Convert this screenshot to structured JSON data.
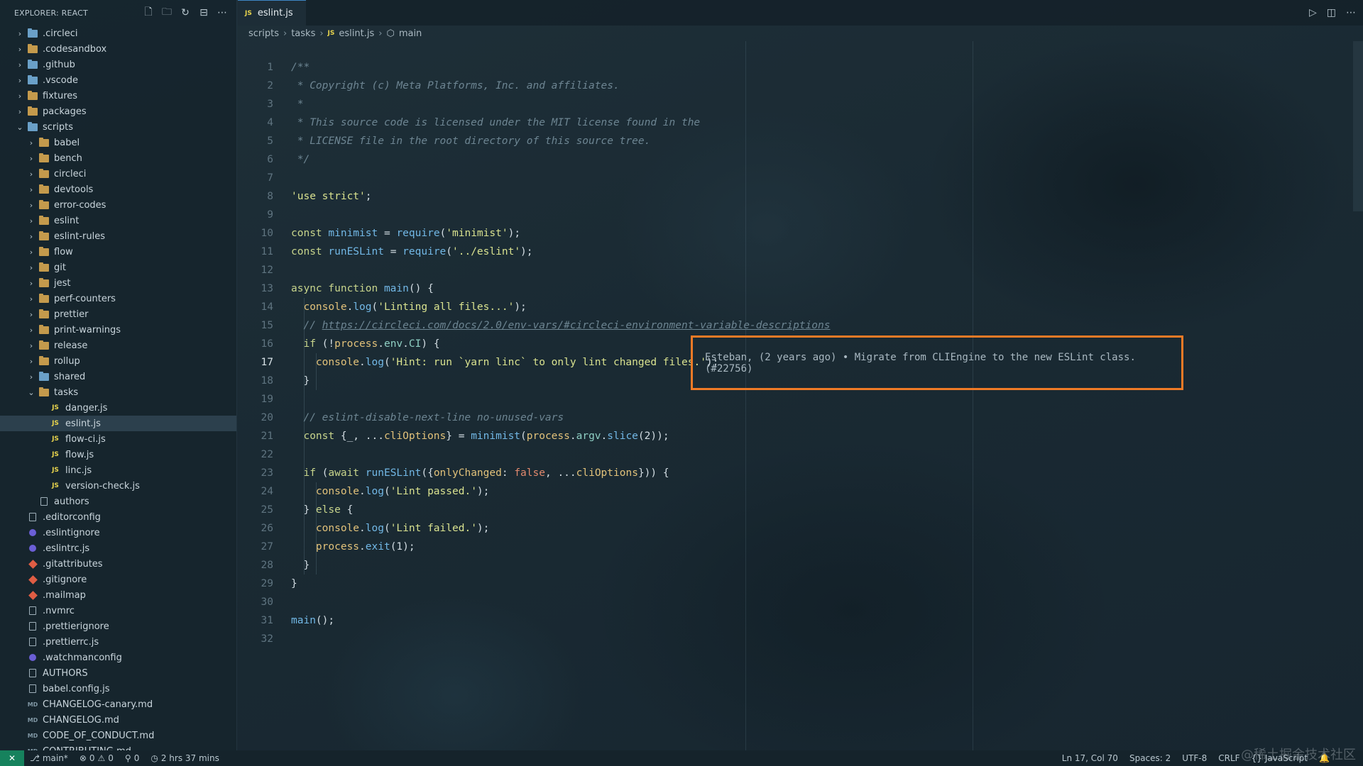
{
  "explorer": {
    "title": "EXPLORER: REACT",
    "actions": [
      "new-file-icon",
      "new-folder-icon",
      "refresh-icon",
      "collapse-icon",
      "more-icon"
    ],
    "items": [
      {
        "label": ".circleci",
        "kind": "folder-special",
        "depth": 0,
        "open": false
      },
      {
        "label": ".codesandbox",
        "kind": "folder",
        "depth": 0,
        "open": false
      },
      {
        "label": ".github",
        "kind": "folder-special",
        "depth": 0,
        "open": false
      },
      {
        "label": ".vscode",
        "kind": "folder-special",
        "depth": 0,
        "open": false
      },
      {
        "label": "fixtures",
        "kind": "folder",
        "depth": 0,
        "open": false
      },
      {
        "label": "packages",
        "kind": "folder",
        "depth": 0,
        "open": false
      },
      {
        "label": "scripts",
        "kind": "folder-special",
        "depth": 0,
        "open": true
      },
      {
        "label": "babel",
        "kind": "folder",
        "depth": 1,
        "open": false
      },
      {
        "label": "bench",
        "kind": "folder",
        "depth": 1,
        "open": false
      },
      {
        "label": "circleci",
        "kind": "folder",
        "depth": 1,
        "open": false
      },
      {
        "label": "devtools",
        "kind": "folder",
        "depth": 1,
        "open": false
      },
      {
        "label": "error-codes",
        "kind": "folder",
        "depth": 1,
        "open": false
      },
      {
        "label": "eslint",
        "kind": "folder",
        "depth": 1,
        "open": false
      },
      {
        "label": "eslint-rules",
        "kind": "folder",
        "depth": 1,
        "open": false
      },
      {
        "label": "flow",
        "kind": "folder",
        "depth": 1,
        "open": false
      },
      {
        "label": "git",
        "kind": "folder",
        "depth": 1,
        "open": false
      },
      {
        "label": "jest",
        "kind": "folder",
        "depth": 1,
        "open": false
      },
      {
        "label": "perf-counters",
        "kind": "folder",
        "depth": 1,
        "open": false
      },
      {
        "label": "prettier",
        "kind": "folder",
        "depth": 1,
        "open": false
      },
      {
        "label": "print-warnings",
        "kind": "folder",
        "depth": 1,
        "open": false
      },
      {
        "label": "release",
        "kind": "folder",
        "depth": 1,
        "open": false
      },
      {
        "label": "rollup",
        "kind": "folder",
        "depth": 1,
        "open": false
      },
      {
        "label": "shared",
        "kind": "folder-special",
        "depth": 1,
        "open": false
      },
      {
        "label": "tasks",
        "kind": "folder",
        "depth": 1,
        "open": true
      },
      {
        "label": "danger.js",
        "kind": "js",
        "depth": 2
      },
      {
        "label": "eslint.js",
        "kind": "js",
        "depth": 2,
        "active": true
      },
      {
        "label": "flow-ci.js",
        "kind": "js",
        "depth": 2
      },
      {
        "label": "flow.js",
        "kind": "js",
        "depth": 2
      },
      {
        "label": "linc.js",
        "kind": "js",
        "depth": 2
      },
      {
        "label": "version-check.js",
        "kind": "js",
        "depth": 2
      },
      {
        "label": "authors",
        "kind": "file",
        "depth": 1
      },
      {
        "label": ".editorconfig",
        "kind": "file",
        "depth": 0
      },
      {
        "label": ".eslintignore",
        "kind": "dot",
        "depth": 0
      },
      {
        "label": ".eslintrc.js",
        "kind": "dot",
        "depth": 0
      },
      {
        "label": ".gitattributes",
        "kind": "git",
        "depth": 0
      },
      {
        "label": ".gitignore",
        "kind": "git",
        "depth": 0
      },
      {
        "label": ".mailmap",
        "kind": "git",
        "depth": 0
      },
      {
        "label": ".nvmrc",
        "kind": "file",
        "depth": 0
      },
      {
        "label": ".prettierignore",
        "kind": "file",
        "depth": 0
      },
      {
        "label": ".prettierrc.js",
        "kind": "file",
        "depth": 0
      },
      {
        "label": ".watchmanconfig",
        "kind": "dot",
        "depth": 0
      },
      {
        "label": "AUTHORS",
        "kind": "file",
        "depth": 0
      },
      {
        "label": "babel.config.js",
        "kind": "file",
        "depth": 0
      },
      {
        "label": "CHANGELOG-canary.md",
        "kind": "md",
        "depth": 0
      },
      {
        "label": "CHANGELOG.md",
        "kind": "md",
        "depth": 0
      },
      {
        "label": "CODE_OF_CONDUCT.md",
        "kind": "md",
        "depth": 0
      },
      {
        "label": "CONTRIBUTING.md",
        "kind": "md",
        "depth": 0
      }
    ]
  },
  "tab": {
    "icon": "JS",
    "label": "eslint.js"
  },
  "editor_actions": [
    "run-icon",
    "split-editor-icon",
    "more-icon"
  ],
  "breadcrumb": {
    "parts": [
      "scripts",
      "tasks",
      "eslint.js",
      "main"
    ],
    "js_icon": "JS"
  },
  "code": {
    "current_line": 17,
    "lines": [
      [
        {
          "t": "/**",
          "c": "com"
        }
      ],
      [
        {
          "t": " * Copyright (c) Meta Platforms, Inc. and affiliates.",
          "c": "com"
        }
      ],
      [
        {
          "t": " *",
          "c": "com"
        }
      ],
      [
        {
          "t": " * This source code is licensed under the MIT license found in the",
          "c": "com"
        }
      ],
      [
        {
          "t": " * LICENSE file in the root directory of this source tree.",
          "c": "com"
        }
      ],
      [
        {
          "t": " */",
          "c": "com"
        }
      ],
      [],
      [
        {
          "t": "'use strict'",
          "c": "str"
        },
        {
          "t": ";",
          "c": "pl"
        }
      ],
      [],
      [
        {
          "t": "const ",
          "c": "kw"
        },
        {
          "t": "minimist",
          "c": "fn"
        },
        {
          "t": " = ",
          "c": "pl"
        },
        {
          "t": "require",
          "c": "fn"
        },
        {
          "t": "(",
          "c": "pl"
        },
        {
          "t": "'minimist'",
          "c": "str"
        },
        {
          "t": ");",
          "c": "pl"
        }
      ],
      [
        {
          "t": "const ",
          "c": "kw"
        },
        {
          "t": "runESLint",
          "c": "fn"
        },
        {
          "t": " = ",
          "c": "pl"
        },
        {
          "t": "require",
          "c": "fn"
        },
        {
          "t": "(",
          "c": "pl"
        },
        {
          "t": "'../eslint'",
          "c": "str"
        },
        {
          "t": ");",
          "c": "pl"
        }
      ],
      [],
      [
        {
          "t": "async function ",
          "c": "kw"
        },
        {
          "t": "main",
          "c": "fn"
        },
        {
          "t": "() {",
          "c": "pl"
        }
      ],
      [
        {
          "t": "  console",
          "c": "var"
        },
        {
          "t": ".",
          "c": "pl"
        },
        {
          "t": "log",
          "c": "fn"
        },
        {
          "t": "(",
          "c": "pl"
        },
        {
          "t": "'Linting all files...'",
          "c": "str"
        },
        {
          "t": ");",
          "c": "pl"
        }
      ],
      [
        {
          "t": "  // ",
          "c": "com"
        },
        {
          "t": "https://circleci.com/docs/2.0/env-vars/#circleci-environment-variable-descriptions",
          "c": "url"
        }
      ],
      [
        {
          "t": "  if ",
          "c": "kw"
        },
        {
          "t": "(!",
          "c": "pl"
        },
        {
          "t": "process",
          "c": "var"
        },
        {
          "t": ".",
          "c": "pl"
        },
        {
          "t": "env",
          "c": "pr"
        },
        {
          "t": ".",
          "c": "pl"
        },
        {
          "t": "CI",
          "c": "pr"
        },
        {
          "t": ") {",
          "c": "pl"
        }
      ],
      [
        {
          "t": "    console",
          "c": "var"
        },
        {
          "t": ".",
          "c": "pl"
        },
        {
          "t": "log",
          "c": "fn"
        },
        {
          "t": "(",
          "c": "pl"
        },
        {
          "t": "'Hint: run `yarn linc` to only lint changed files.'",
          "c": "str"
        },
        {
          "t": ");",
          "c": "pl"
        }
      ],
      [
        {
          "t": "  }",
          "c": "pl"
        }
      ],
      [],
      [
        {
          "t": "  // eslint-disable-next-line no-unused-vars",
          "c": "com"
        }
      ],
      [
        {
          "t": "  const ",
          "c": "kw"
        },
        {
          "t": "{_, ...",
          "c": "pl"
        },
        {
          "t": "cliOptions",
          "c": "var"
        },
        {
          "t": "} = ",
          "c": "pl"
        },
        {
          "t": "minimist",
          "c": "fn"
        },
        {
          "t": "(",
          "c": "pl"
        },
        {
          "t": "process",
          "c": "var"
        },
        {
          "t": ".",
          "c": "pl"
        },
        {
          "t": "argv",
          "c": "pr"
        },
        {
          "t": ".",
          "c": "pl"
        },
        {
          "t": "slice",
          "c": "fn"
        },
        {
          "t": "(2));",
          "c": "pl"
        }
      ],
      [],
      [
        {
          "t": "  if ",
          "c": "kw"
        },
        {
          "t": "(",
          "c": "pl"
        },
        {
          "t": "await ",
          "c": "kw"
        },
        {
          "t": "runESLint",
          "c": "fn"
        },
        {
          "t": "({",
          "c": "pl"
        },
        {
          "t": "onlyChanged",
          "c": "var"
        },
        {
          "t": ": ",
          "c": "pl"
        },
        {
          "t": "false",
          "c": "bool"
        },
        {
          "t": ", ...",
          "c": "pl"
        },
        {
          "t": "cliOptions",
          "c": "var"
        },
        {
          "t": "})) {",
          "c": "pl"
        }
      ],
      [
        {
          "t": "    console",
          "c": "var"
        },
        {
          "t": ".",
          "c": "pl"
        },
        {
          "t": "log",
          "c": "fn"
        },
        {
          "t": "(",
          "c": "pl"
        },
        {
          "t": "'Lint passed.'",
          "c": "str"
        },
        {
          "t": ");",
          "c": "pl"
        }
      ],
      [
        {
          "t": "  } ",
          "c": "pl"
        },
        {
          "t": "else",
          "c": "kw"
        },
        {
          "t": " {",
          "c": "pl"
        }
      ],
      [
        {
          "t": "    console",
          "c": "var"
        },
        {
          "t": ".",
          "c": "pl"
        },
        {
          "t": "log",
          "c": "fn"
        },
        {
          "t": "(",
          "c": "pl"
        },
        {
          "t": "'Lint failed.'",
          "c": "str"
        },
        {
          "t": ");",
          "c": "pl"
        }
      ],
      [
        {
          "t": "    process",
          "c": "var"
        },
        {
          "t": ".",
          "c": "pl"
        },
        {
          "t": "exit",
          "c": "fn"
        },
        {
          "t": "(1);",
          "c": "pl"
        }
      ],
      [
        {
          "t": "  }",
          "c": "pl"
        }
      ],
      [
        {
          "t": "}",
          "c": "pl"
        }
      ],
      [],
      [
        {
          "t": "main",
          "c": "fn"
        },
        {
          "t": "();",
          "c": "pl"
        }
      ],
      []
    ]
  },
  "blame": {
    "text": "Esteban, (2 years ago) • Migrate from CLIEngine to the new ESLint class. (#22756)"
  },
  "statusbar": {
    "branch": "main*",
    "errors": "0",
    "warnings": "0",
    "ports": "0",
    "time": "2 hrs 37 mins",
    "position": "Ln 17, Col 70",
    "spaces": "Spaces: 2",
    "encoding": "UTF-8",
    "eol": "CRLF",
    "language": "JavaScript",
    "watermark": "@稀土掘金技术社区"
  }
}
